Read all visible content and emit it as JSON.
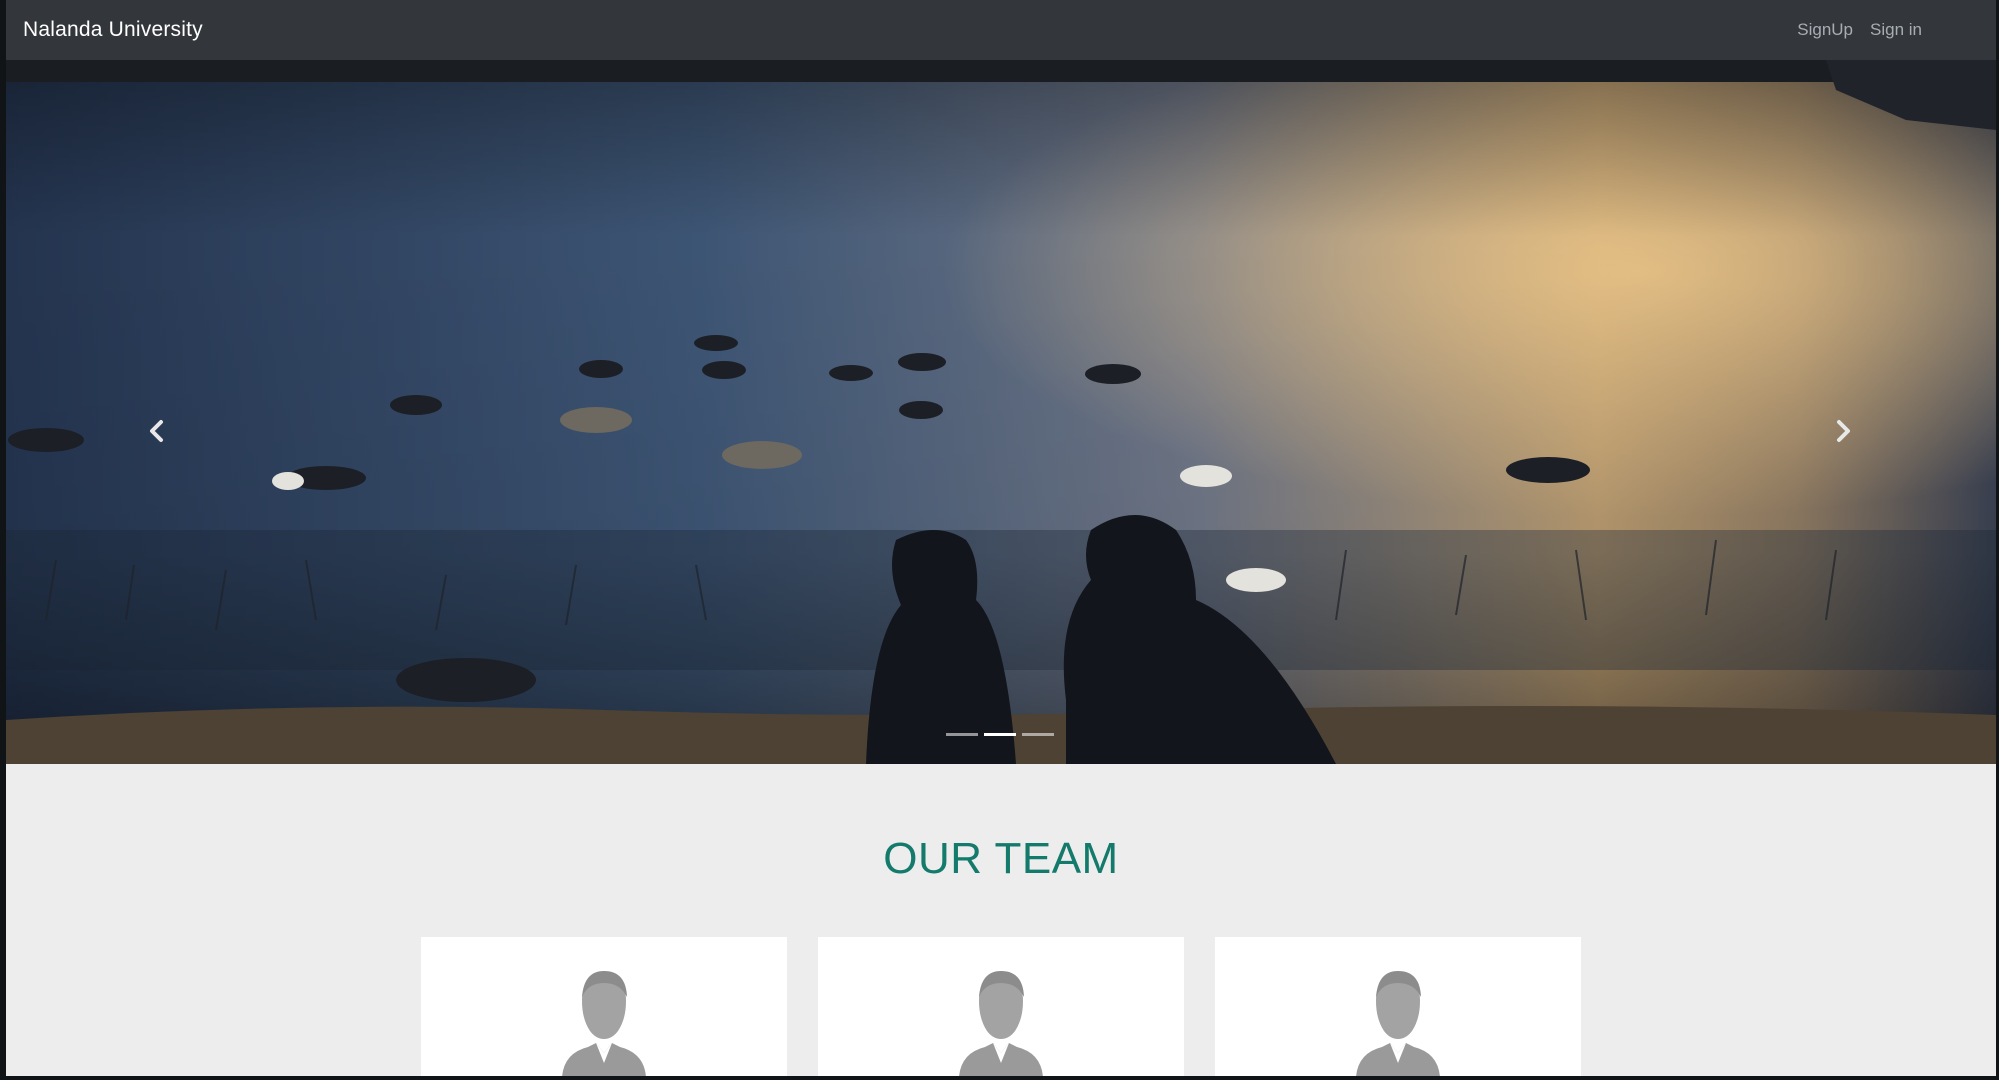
{
  "navbar": {
    "brand": "Nalanda University",
    "links": [
      "SignUp",
      "Sign in"
    ]
  },
  "carousel": {
    "slide_count": 3,
    "active_index": 1,
    "prev_icon": "chevron-left-icon",
    "next_icon": "chevron-right-icon"
  },
  "team": {
    "title": "OUR TEAM",
    "members": [
      {
        "avatar_icon": "person-silhouette-icon"
      },
      {
        "avatar_icon": "person-silhouette-icon"
      },
      {
        "avatar_icon": "person-silhouette-icon"
      }
    ]
  },
  "colors": {
    "navbar_bg": "#33373c",
    "team_title": "#147a6b",
    "section_bg": "#ededed"
  }
}
